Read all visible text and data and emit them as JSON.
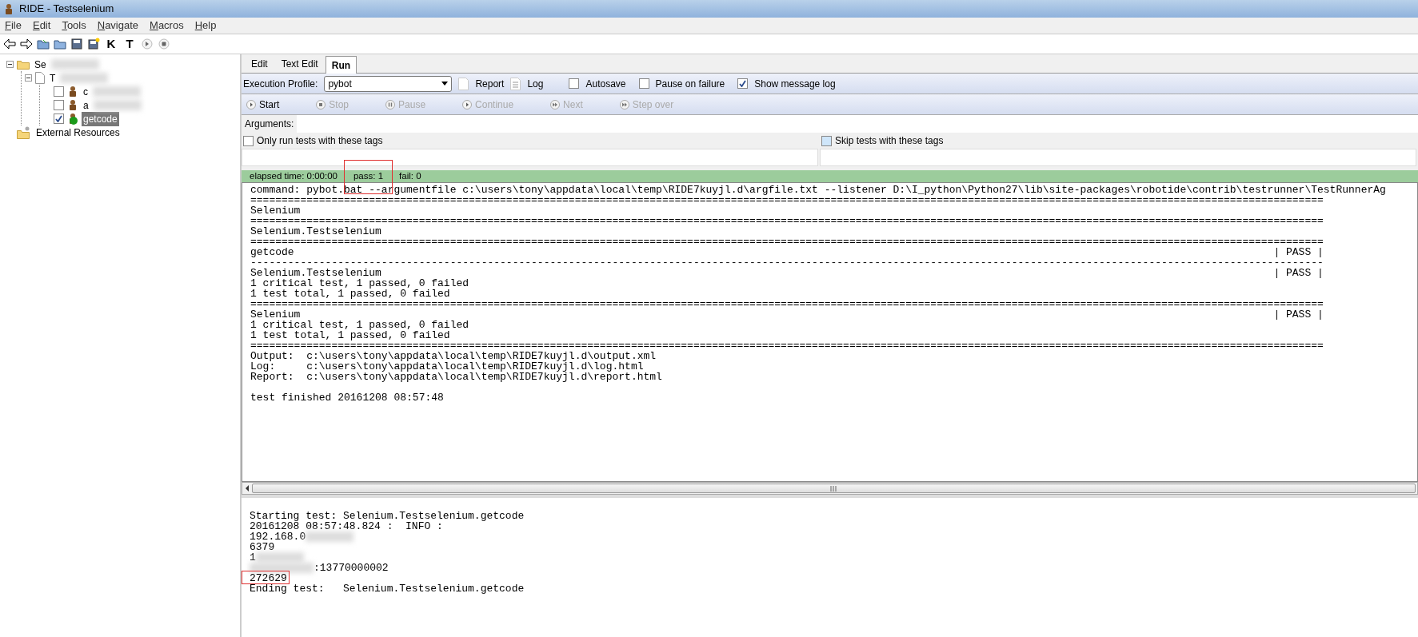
{
  "window": {
    "title": "RIDE - Testselenium"
  },
  "menu": [
    "File",
    "Edit",
    "Tools",
    "Navigate",
    "Macros",
    "Help"
  ],
  "toolbar": [
    {
      "kind": "back"
    },
    {
      "kind": "forward"
    },
    {
      "kind": "open"
    },
    {
      "kind": "folder"
    },
    {
      "kind": "save"
    },
    {
      "kind": "save-all"
    },
    {
      "kind": "letter",
      "label": "K"
    },
    {
      "kind": "letter",
      "label": "T"
    },
    {
      "kind": "run"
    },
    {
      "kind": "stop"
    }
  ],
  "tree": [
    {
      "kind": "suite",
      "label": "Se",
      "redacted": true,
      "expanded": true,
      "children": [
        {
          "kind": "file",
          "label": "T",
          "redacted": true,
          "expanded": true,
          "children": [
            {
              "kind": "test",
              "label": "c",
              "redacted": true,
              "checked": false,
              "selected": false,
              "passed": false
            },
            {
              "kind": "test",
              "label": "a",
              "redacted": true,
              "checked": false,
              "selected": false,
              "passed": false
            },
            {
              "kind": "test",
              "label": "getcode",
              "checked": true,
              "selected": true,
              "passed": true
            }
          ]
        }
      ]
    },
    {
      "kind": "resources",
      "label": "External Resources"
    }
  ],
  "tabs": [
    {
      "label": "Edit",
      "selected": false
    },
    {
      "label": "Text Edit",
      "selected": false
    },
    {
      "label": "Run",
      "selected": true
    }
  ],
  "run": {
    "profile_label": "Execution Profile:",
    "profile": "pybot",
    "report": "Report",
    "log": "Log",
    "options": [
      {
        "label": "Autosave",
        "checked": false
      },
      {
        "label": "Pause on failure",
        "checked": false
      },
      {
        "label": "Show message log",
        "checked": true
      }
    ],
    "actions": [
      {
        "label": "Start",
        "kind": "play",
        "disabled": false
      },
      {
        "label": "Stop",
        "kind": "stop",
        "disabled": true
      },
      {
        "label": "Pause",
        "kind": "pause",
        "disabled": true
      },
      {
        "label": "Continue",
        "kind": "play",
        "disabled": true
      },
      {
        "label": "Next",
        "kind": "skip",
        "disabled": true
      },
      {
        "label": "Step over",
        "kind": "skip",
        "disabled": true
      }
    ],
    "arguments_label": "Arguments:",
    "tag_filters": [
      {
        "label": "Only run tests with these tags",
        "checked": false
      },
      {
        "label": "Skip tests with these tags",
        "checked": false
      }
    ],
    "status": [
      {
        "text": "elapsed time: 0:00:00",
        "highlighted": false
      },
      {
        "text": "pass: 1",
        "highlighted": true
      },
      {
        "text": "fail: 0",
        "highlighted": false
      }
    ],
    "output": [
      {
        "kind": "text",
        "text": "command: pybot.bat --argumentfile c:\\users\\tony\\appdata\\local\\temp\\RIDE7kuyjl.d\\argfile.txt --listener D:\\I_python\\Python27\\lib\\site-packages\\robotide\\contrib\\testrunner\\TestRunnerAg"
      },
      {
        "kind": "rule",
        "text": "============================================================================================================================================================================"
      },
      {
        "kind": "text",
        "text": "Selenium"
      },
      {
        "kind": "rule",
        "text": "============================================================================================================================================================================"
      },
      {
        "kind": "text",
        "text": "Selenium.Testselenium"
      },
      {
        "kind": "rule",
        "text": "============================================================================================================================================================================"
      },
      {
        "kind": "result",
        "text": "getcode",
        "status": "| PASS |"
      },
      {
        "kind": "rule",
        "text": "----------------------------------------------------------------------------------------------------------------------------------------------------------------------------"
      },
      {
        "kind": "result",
        "text": "Selenium.Testselenium",
        "status": "| PASS |"
      },
      {
        "kind": "text",
        "text": "1 critical test, 1 passed, 0 failed"
      },
      {
        "kind": "text",
        "text": "1 test total, 1 passed, 0 failed"
      },
      {
        "kind": "rule",
        "text": "============================================================================================================================================================================"
      },
      {
        "kind": "result",
        "text": "Selenium",
        "status": "| PASS |"
      },
      {
        "kind": "text",
        "text": "1 critical test, 1 passed, 0 failed"
      },
      {
        "kind": "text",
        "text": "1 test total, 1 passed, 0 failed"
      },
      {
        "kind": "rule",
        "text": "============================================================================================================================================================================"
      },
      {
        "kind": "text",
        "text": "Output:  c:\\users\\tony\\appdata\\local\\temp\\RIDE7kuyjl.d\\output.xml"
      },
      {
        "kind": "text",
        "text": "Log:     c:\\users\\tony\\appdata\\local\\temp\\RIDE7kuyjl.d\\log.html"
      },
      {
        "kind": "text",
        "text": "Report:  c:\\users\\tony\\appdata\\local\\temp\\RIDE7kuyjl.d\\report.html"
      },
      {
        "kind": "blank"
      },
      {
        "kind": "text",
        "text": "test finished 20161208 08:57:48"
      }
    ],
    "message_log": [
      {
        "text": "Starting test: Selenium.Testselenium.getcode"
      },
      {
        "text": "20161208 08:57:48.824 :  INFO :"
      },
      {
        "text": "192.168.0",
        "blur_after": true
      },
      {
        "text": "6379"
      },
      {
        "text": "1",
        "blur_after": true
      },
      {
        "text": ":13770000002",
        "blur_before": true
      },
      {
        "text": "272629",
        "highlighted": true
      },
      {
        "text": "Ending test:   Selenium.Testselenium.getcode"
      }
    ]
  }
}
